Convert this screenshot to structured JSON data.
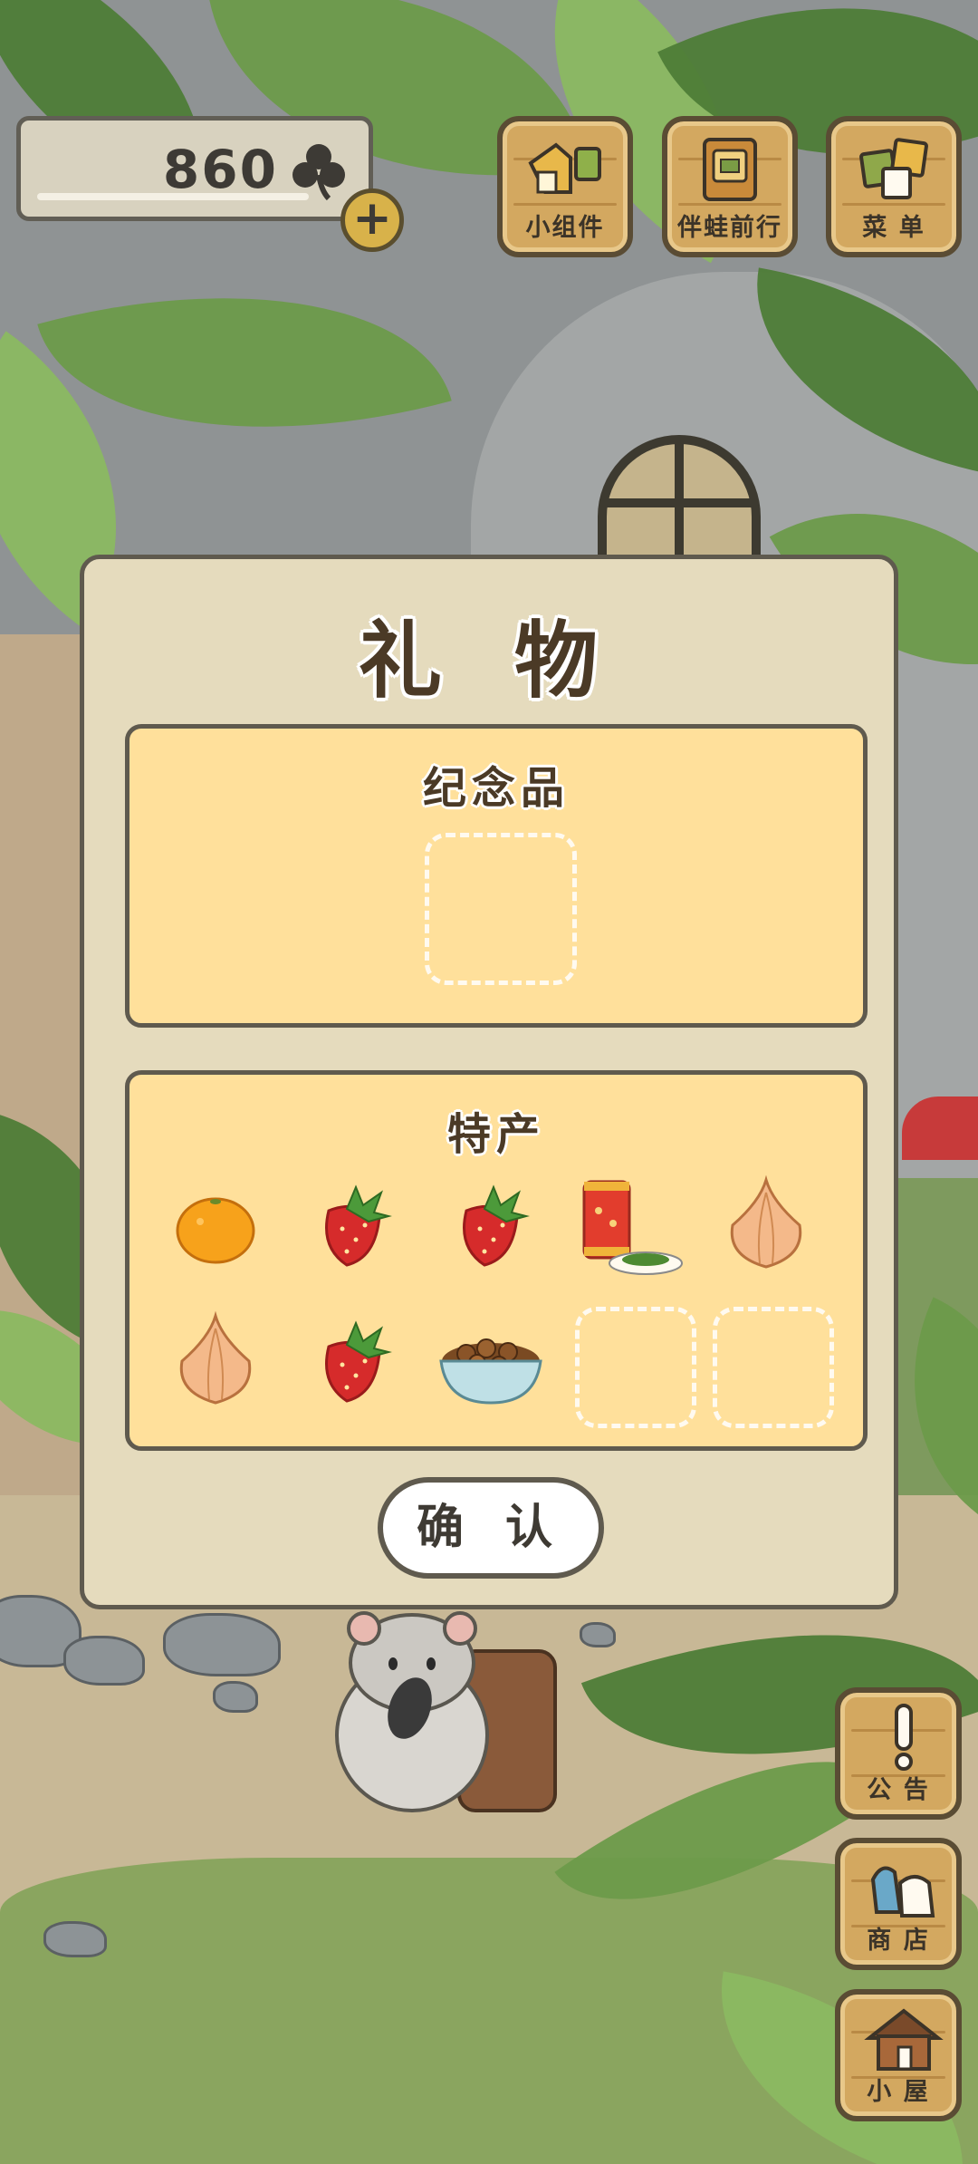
{
  "hud": {
    "clover_count": "860",
    "clover_icon": "clover-icon",
    "add_icon": "+"
  },
  "top_buttons": {
    "widget": "小组件",
    "frog_companion": "伴蛙前行",
    "menu": "菜 单"
  },
  "side_buttons": {
    "notice": "公 告",
    "shop": "商 店",
    "house": "小 屋"
  },
  "dialog": {
    "title": "礼 物",
    "souvenir_section": {
      "title": "纪念品",
      "slots": [
        {
          "item": null
        }
      ]
    },
    "specialty_section": {
      "title": "特产",
      "items": [
        {
          "item": "orange"
        },
        {
          "item": "strawberry"
        },
        {
          "item": "strawberry"
        },
        {
          "item": "tea-canister-with-tea-leaves"
        },
        {
          "item": "onion"
        },
        {
          "item": "onion"
        },
        {
          "item": "strawberry"
        },
        {
          "item": "bowl-of-chestnuts"
        },
        {
          "item": null
        },
        {
          "item": null
        }
      ]
    },
    "confirm_label": "确 认"
  },
  "colors": {
    "dialog_bg": "#e5dbbd",
    "panel_bg": "#ffe09b",
    "border": "#5f5a4e",
    "wood": "#d3a860"
  }
}
